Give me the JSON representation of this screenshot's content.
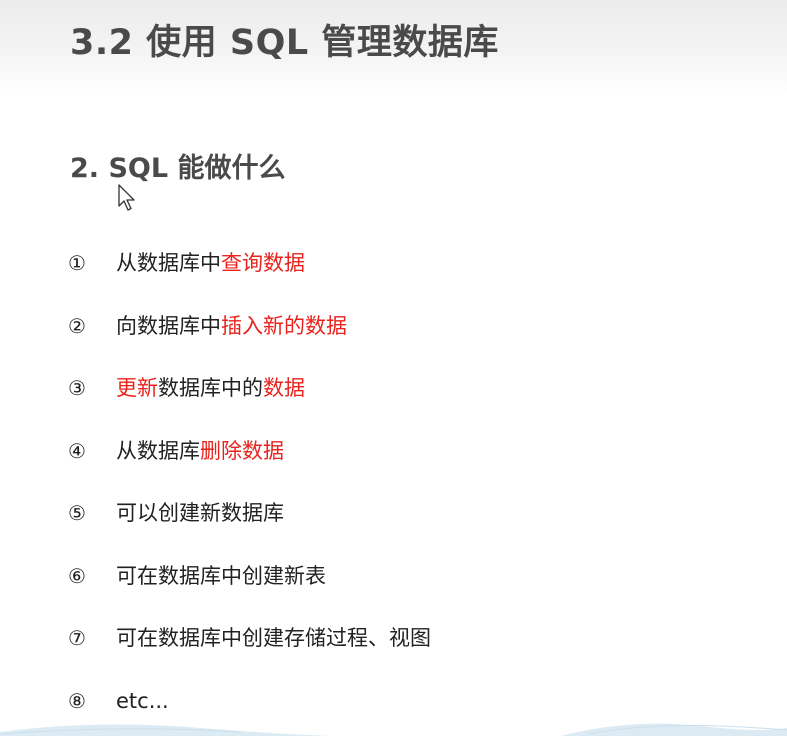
{
  "slide": {
    "title": "3.2 使用 SQL 管理数据库",
    "heading": "2. SQL 能做什么"
  },
  "items": [
    {
      "num": "①",
      "segments": [
        {
          "text": "从数据库中",
          "hl": false
        },
        {
          "text": "查询数据",
          "hl": true
        }
      ]
    },
    {
      "num": "②",
      "segments": [
        {
          "text": "向数据库中",
          "hl": false
        },
        {
          "text": "插入新的数据",
          "hl": true
        }
      ]
    },
    {
      "num": "③",
      "segments": [
        {
          "text": "更新",
          "hl": true
        },
        {
          "text": "数据库中的",
          "hl": false
        },
        {
          "text": "数据",
          "hl": true
        }
      ]
    },
    {
      "num": "④",
      "segments": [
        {
          "text": "从数据库",
          "hl": false
        },
        {
          "text": "删除数据",
          "hl": true
        }
      ]
    },
    {
      "num": "⑤",
      "segments": [
        {
          "text": "可以创建新数据库",
          "hl": false
        }
      ]
    },
    {
      "num": "⑥",
      "segments": [
        {
          "text": "可在数据库中创建新表",
          "hl": false
        }
      ]
    },
    {
      "num": "⑦",
      "segments": [
        {
          "text": "可在数据库中创建存储过程、视图",
          "hl": false
        }
      ]
    },
    {
      "num": "⑧",
      "segments": [
        {
          "text": "etc...",
          "hl": false
        }
      ]
    }
  ],
  "colors": {
    "highlight": "#e8231d",
    "text": "#222222",
    "heading": "#4a4a4a"
  },
  "icons": {
    "cursor": "mouse-pointer-icon"
  }
}
